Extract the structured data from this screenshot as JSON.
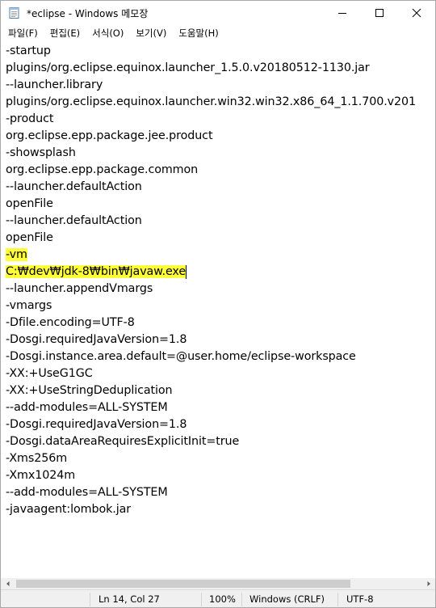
{
  "window": {
    "title": "*eclipse - Windows 메모장"
  },
  "menu": {
    "items": [
      "파일(F)",
      "편집(E)",
      "서식(O)",
      "보기(V)",
      "도움말(H)"
    ]
  },
  "editor": {
    "lines": [
      "-startup",
      "plugins/org.eclipse.equinox.launcher_1.5.0.v20180512-1130.jar",
      "--launcher.library",
      "plugins/org.eclipse.equinox.launcher.win32.win32.x86_64_1.1.700.v201",
      "-product",
      "org.eclipse.epp.package.jee.product",
      "-showsplash",
      "org.eclipse.epp.package.common",
      "--launcher.defaultAction",
      "openFile",
      "--launcher.defaultAction",
      "openFile",
      "-vm",
      "C:₩dev₩jdk-8₩bin₩javaw.exe",
      "--launcher.appendVmargs",
      "-vmargs",
      "-Dfile.encoding=UTF-8",
      "-Dosgi.requiredJavaVersion=1.8",
      "-Dosgi.instance.area.default=@user.home/eclipse-workspace",
      "-XX:+UseG1GC",
      "-XX:+UseStringDeduplication",
      "--add-modules=ALL-SYSTEM",
      "-Dosgi.requiredJavaVersion=1.8",
      "-Dosgi.dataAreaRequiresExplicitInit=true",
      "-Xms256m",
      "-Xmx1024m",
      "--add-modules=ALL-SYSTEM",
      "-javaagent:lombok.jar"
    ],
    "highlighted_lines": [
      12,
      13
    ],
    "highlight_color": "#ffff3a"
  },
  "status": {
    "position": "Ln 14, Col 27",
    "zoom": "100%",
    "line_ending": "Windows (CRLF)",
    "encoding": "UTF-8"
  },
  "icons": {
    "app": "notepad-icon",
    "minimize": "minimize-icon",
    "maximize": "maximize-icon",
    "close": "close-icon",
    "scroll_left": "scroll-left-arrow-icon",
    "scroll_right": "scroll-right-arrow-icon"
  }
}
